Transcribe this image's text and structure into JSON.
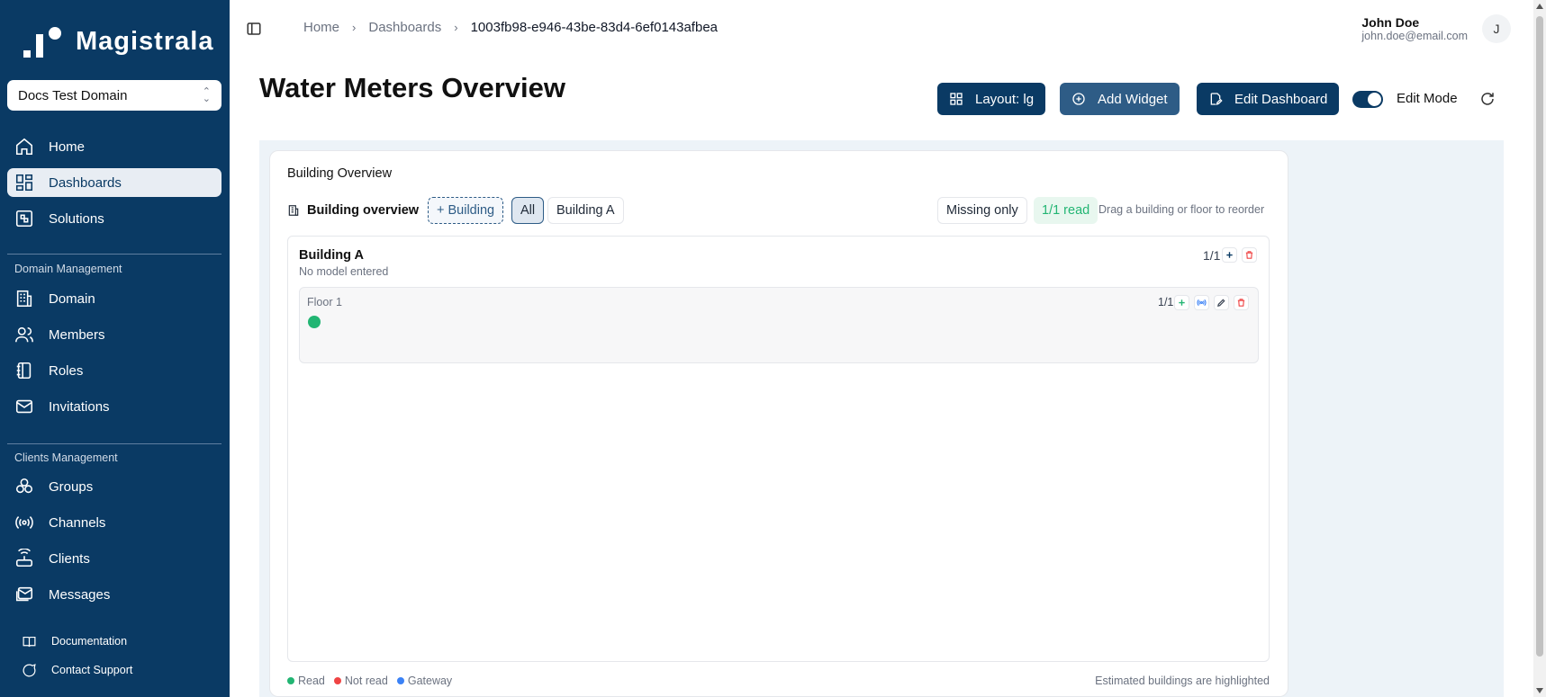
{
  "app": {
    "name": "Magistrala"
  },
  "domain_selector": {
    "value": "Docs Test Domain"
  },
  "sidebar": {
    "main_items": [
      {
        "label": "Home",
        "icon": "home-icon"
      },
      {
        "label": "Dashboards",
        "icon": "dashboard-icon",
        "active": true
      },
      {
        "label": "Solutions",
        "icon": "solutions-icon"
      }
    ],
    "domain_section": {
      "title": "Domain Management",
      "items": [
        {
          "label": "Domain",
          "icon": "building-icon"
        },
        {
          "label": "Members",
          "icon": "users-icon"
        },
        {
          "label": "Roles",
          "icon": "notebook-icon"
        },
        {
          "label": "Invitations",
          "icon": "mail-icon"
        }
      ]
    },
    "clients_section": {
      "title": "Clients Management",
      "items": [
        {
          "label": "Groups",
          "icon": "groups-icon"
        },
        {
          "label": "Channels",
          "icon": "broadcast-icon"
        },
        {
          "label": "Clients",
          "icon": "router-icon"
        },
        {
          "label": "Messages",
          "icon": "messages-icon"
        }
      ]
    },
    "footer_items": [
      {
        "label": "Documentation",
        "icon": "book-icon"
      },
      {
        "label": "Contact Support",
        "icon": "chat-icon"
      }
    ]
  },
  "breadcrumb": {
    "items": [
      "Home",
      "Dashboards"
    ],
    "current": "1003fb98-e946-43be-83d4-6ef0143afbea"
  },
  "user": {
    "name": "John Doe",
    "email": "john.doe@email.com",
    "initial": "J"
  },
  "page": {
    "title": "Water Meters Overview"
  },
  "actions": {
    "layout_label": "Layout: lg",
    "add_widget_label": "Add Widget",
    "edit_dashboard_label": "Edit Dashboard",
    "edit_mode_label": "Edit Mode",
    "edit_mode_on": true
  },
  "widget": {
    "title": "Building Overview",
    "toolbar": {
      "label": "Building overview",
      "add_building": "+ Building",
      "filters": [
        "All",
        "Building A"
      ],
      "selected_filter": "All",
      "missing_only": "Missing only",
      "read_badge": "1/1 read",
      "hint": "Drag a building or floor to reorder"
    },
    "buildings": [
      {
        "name": "Building A",
        "model": "No model entered",
        "count": "1/1",
        "floors": [
          {
            "name": "Floor 1",
            "count": "1/1",
            "meters": [
              {
                "status": "read"
              }
            ]
          }
        ]
      }
    ],
    "legend": [
      {
        "label": "Read",
        "color": "#22b573"
      },
      {
        "label": "Not read",
        "color": "#ef4444"
      },
      {
        "label": "Gateway",
        "color": "#3b82f6"
      }
    ],
    "legend_note": "Estimated buildings are highlighted"
  },
  "colors": {
    "sidebar": "#0a3a64",
    "primary": "#0a3a64",
    "read": "#22b573",
    "danger": "#ef4444",
    "canvas": "#edf3f8"
  }
}
